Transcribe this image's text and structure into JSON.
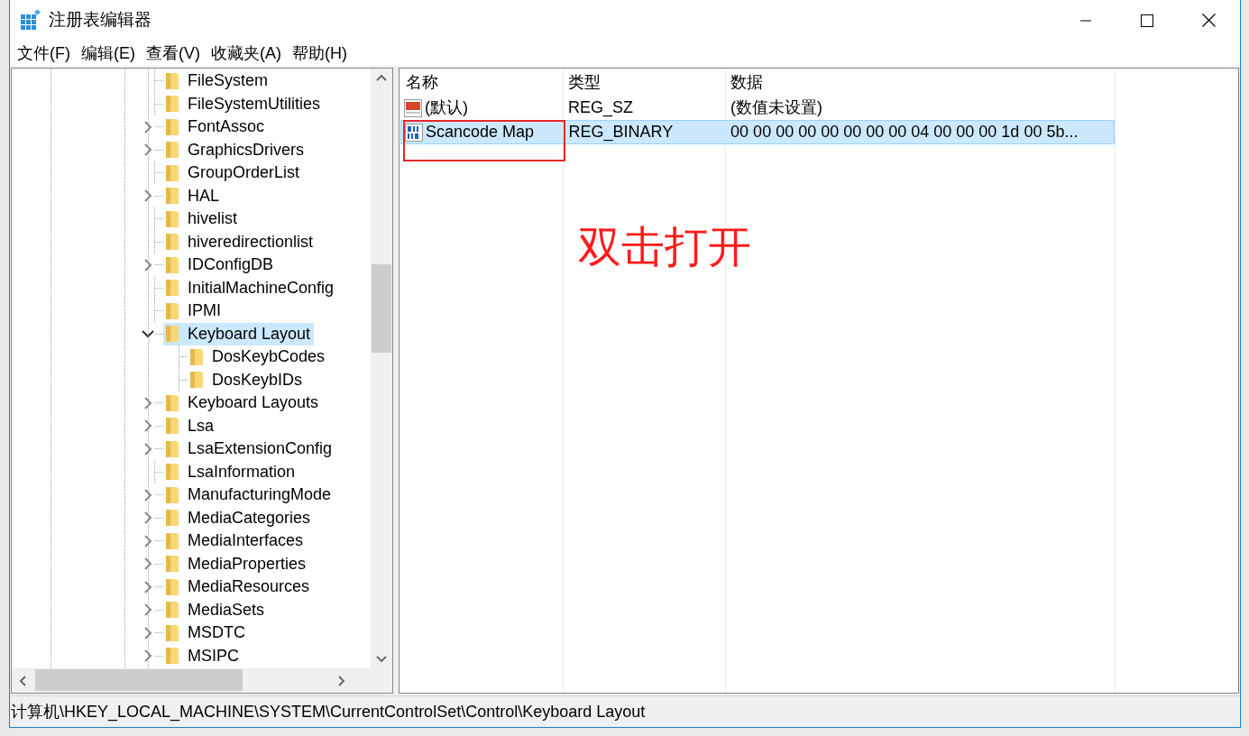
{
  "window": {
    "title": "注册表编辑器"
  },
  "menu": [
    {
      "label": "文件(F)"
    },
    {
      "label": "编辑(E)"
    },
    {
      "label": "查看(V)"
    },
    {
      "label": "收藏夹(A)"
    },
    {
      "label": "帮助(H)"
    }
  ],
  "tree": {
    "items": [
      {
        "label": "FileSystem",
        "expandable": false,
        "selected": false
      },
      {
        "label": "FileSystemUtilities",
        "expandable": false,
        "selected": false
      },
      {
        "label": "FontAssoc",
        "expandable": true,
        "expanded": false,
        "selected": false
      },
      {
        "label": "GraphicsDrivers",
        "expandable": true,
        "expanded": false,
        "selected": false
      },
      {
        "label": "GroupOrderList",
        "expandable": false,
        "selected": false
      },
      {
        "label": "HAL",
        "expandable": true,
        "expanded": false,
        "selected": false
      },
      {
        "label": "hivelist",
        "expandable": false,
        "selected": false
      },
      {
        "label": "hiveredirectionlist",
        "expandable": false,
        "selected": false
      },
      {
        "label": "IDConfigDB",
        "expandable": true,
        "expanded": false,
        "selected": false
      },
      {
        "label": "InitialMachineConfig",
        "expandable": false,
        "selected": false
      },
      {
        "label": "IPMI",
        "expandable": false,
        "selected": false
      },
      {
        "label": "Keyboard Layout",
        "expandable": true,
        "expanded": true,
        "selected": true,
        "children": [
          {
            "label": "DosKeybCodes",
            "expandable": false,
            "selected": false
          },
          {
            "label": "DosKeybIDs",
            "expandable": false,
            "selected": false
          }
        ]
      },
      {
        "label": "Keyboard Layouts",
        "expandable": true,
        "expanded": false,
        "selected": false
      },
      {
        "label": "Lsa",
        "expandable": true,
        "expanded": false,
        "selected": false
      },
      {
        "label": "LsaExtensionConfig",
        "expandable": true,
        "expanded": false,
        "selected": false
      },
      {
        "label": "LsaInformation",
        "expandable": false,
        "selected": false
      },
      {
        "label": "ManufacturingMode",
        "expandable": true,
        "expanded": false,
        "selected": false
      },
      {
        "label": "MediaCategories",
        "expandable": true,
        "expanded": false,
        "selected": false
      },
      {
        "label": "MediaInterfaces",
        "expandable": true,
        "expanded": false,
        "selected": false
      },
      {
        "label": "MediaProperties",
        "expandable": true,
        "expanded": false,
        "selected": false
      },
      {
        "label": "MediaResources",
        "expandable": true,
        "expanded": false,
        "selected": false
      },
      {
        "label": "MediaSets",
        "expandable": true,
        "expanded": false,
        "selected": false
      },
      {
        "label": "MSDTC",
        "expandable": true,
        "expanded": false,
        "selected": false
      },
      {
        "label": "MSIPC",
        "expandable": true,
        "expanded": false,
        "selected": false
      }
    ]
  },
  "values": {
    "columns": [
      "名称",
      "类型",
      "数据"
    ],
    "rows": [
      {
        "kind": "string",
        "name": "(默认)",
        "type": "REG_SZ",
        "data": "(数值未设置)",
        "selected": false,
        "circled": false
      },
      {
        "kind": "binary",
        "name": "Scancode Map",
        "type": "REG_BINARY",
        "data": "00 00 00 00 00 00 00 00 04 00 00 00 1d 00 5b...",
        "selected": true,
        "circled": true
      }
    ]
  },
  "annotation": {
    "text": "双击打开"
  },
  "status_bar": {
    "path": "计算机\\HKEY_LOCAL_MACHINE\\SYSTEM\\CurrentControlSet\\Control\\Keyboard Layout"
  }
}
